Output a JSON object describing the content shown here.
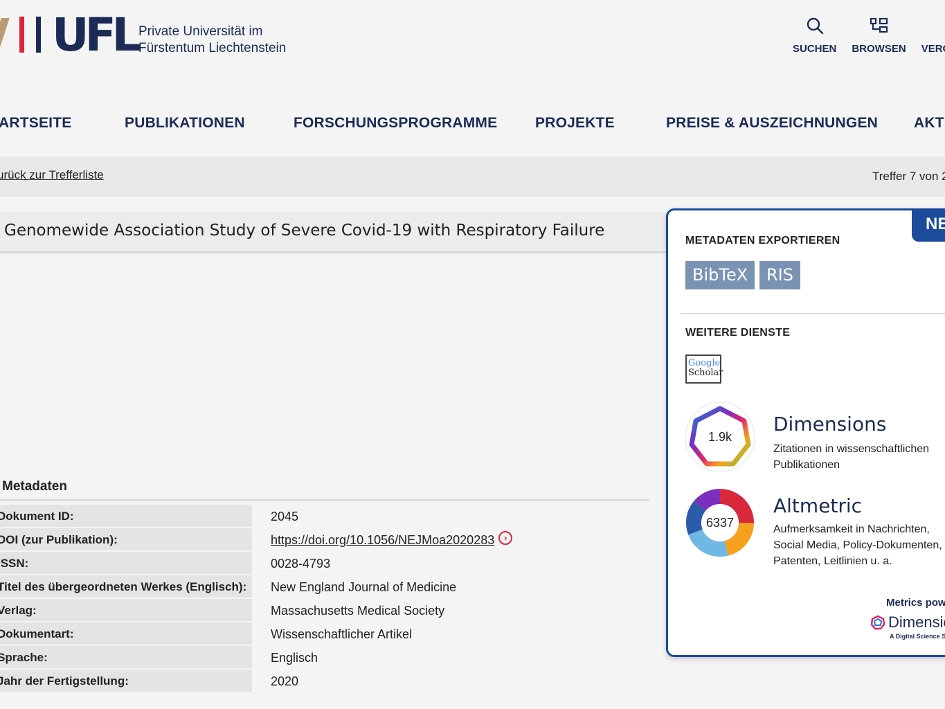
{
  "header": {
    "logo_text": "UFL",
    "logo_sub_line1": "Private Universität im",
    "logo_sub_line2": "Fürstentum Liechtenstein",
    "tools": [
      {
        "label": "SUCHEN",
        "icon": "search-icon"
      },
      {
        "label": "BROWSEN",
        "icon": "browse-icon"
      },
      {
        "label": "VERÖFF",
        "icon": "publish-icon"
      }
    ]
  },
  "nav": {
    "items": [
      "ARTSEITE",
      "PUBLIKATIONEN",
      "FORSCHUNGSPROGRAMME",
      "PROJEKTE",
      "PREISE & AUSZEICHNUNGEN",
      "AKTI"
    ]
  },
  "breadcrumb": {
    "back_label": "urück zur Trefferliste",
    "hits": "Treffer 7 von 2"
  },
  "document": {
    "title": "Genomewide Association Study of Severe Covid-19 with Respiratory Failure"
  },
  "metadata": {
    "heading": "Metadaten",
    "rows": [
      {
        "key": "Dokument ID:",
        "value": "2045"
      },
      {
        "key": "DOI (zur Publikation):",
        "value": "https://doi.org/10.1056/NEJMoa2020283"
      },
      {
        "key": "ISSN:",
        "value": "0028-4793"
      },
      {
        "key": "Titel des übergeordneten Werkes (Englisch):",
        "value": "New England Journal of Medicine"
      },
      {
        "key": "Verlag:",
        "value": "Massachusetts Medical Society"
      },
      {
        "key": "Dokumentart:",
        "value": "Wissenschaftlicher Artikel"
      },
      {
        "key": "Sprache:",
        "value": "Englisch"
      },
      {
        "key": "Jahr der Fertigstellung:",
        "value": "2020"
      }
    ]
  },
  "sidebar": {
    "badge": "NE",
    "export_title": "METADATEN EXPORTIEREN",
    "export_buttons": [
      "BibTeX",
      "RIS"
    ],
    "services_title": "WEITERE DIENSTE",
    "google_scholar": {
      "line1": "Google",
      "line2": "Scholar"
    },
    "dimensions": {
      "value": "1.9k",
      "title": "Dimensions",
      "desc": "Zitationen in wissenschaftlichen Publikationen"
    },
    "altmetric": {
      "value": "6337",
      "title": "Altmetric",
      "desc": "Aufmerksamkeit in Nachrichten, Social Media, Policy-Dokumenten, Patenten, Leitlinien u. a."
    },
    "powered_by": "Metrics powe",
    "dimensions_logo": "Dimensio",
    "dimensions_logo_sub": "A Digital Science So"
  }
}
